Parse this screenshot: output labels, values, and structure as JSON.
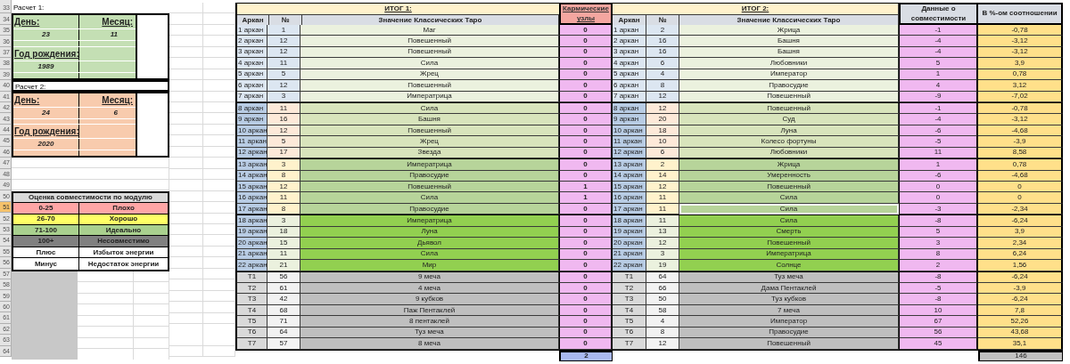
{
  "row_headers": [
    {
      "label": "33",
      "selected": false
    },
    {
      "label": "34",
      "selected": false
    },
    {
      "label": "35",
      "selected": false
    },
    {
      "label": "36",
      "selected": false
    },
    {
      "label": "37",
      "selected": false
    },
    {
      "label": "38",
      "selected": false
    },
    {
      "label": "39",
      "selected": false
    },
    {
      "label": "40",
      "selected": false
    },
    {
      "label": "41",
      "selected": false
    },
    {
      "label": "42",
      "selected": false
    },
    {
      "label": "43",
      "selected": false
    },
    {
      "label": "44",
      "selected": false
    },
    {
      "label": "45",
      "selected": false
    },
    {
      "label": "46",
      "selected": false
    },
    {
      "label": "47",
      "selected": false
    },
    {
      "label": "48",
      "selected": false
    },
    {
      "label": "49",
      "selected": false
    },
    {
      "label": "50",
      "selected": false
    },
    {
      "label": "51",
      "selected": true
    },
    {
      "label": "52",
      "selected": false
    },
    {
      "label": "53",
      "selected": false
    },
    {
      "label": "54",
      "selected": false
    },
    {
      "label": "55",
      "selected": false
    },
    {
      "label": "56",
      "selected": false
    },
    {
      "label": "57",
      "selected": false
    },
    {
      "label": "58",
      "selected": false
    },
    {
      "label": "59",
      "selected": false
    },
    {
      "label": "60",
      "selected": false
    },
    {
      "label": "61",
      "selected": false
    },
    {
      "label": "62",
      "selected": false
    },
    {
      "label": "63",
      "selected": false
    },
    {
      "label": "64",
      "selected": false
    }
  ],
  "calculations": [
    {
      "title": "Расчет 1:",
      "color": "#c4dfb4",
      "day_label": "День:",
      "day": "23",
      "month_label": "Месяц:",
      "month": "11",
      "year_label": "Год рождения:",
      "year": "1989"
    },
    {
      "title": "Расчет 2:",
      "color": "#f8cbad",
      "day_label": "День:",
      "day": "24",
      "month_label": "Месяц:",
      "month": "6",
      "year_label": "Год рождения:",
      "year": "2020"
    }
  ],
  "legend": {
    "title": "Оценка совместимости по модулю",
    "items": [
      {
        "range": "0-25",
        "verdict": "Плохо",
        "color": "#ffa6a6"
      },
      {
        "range": "26-70",
        "verdict": "Хорошо",
        "color": "#ffff66"
      },
      {
        "range": "71-100",
        "verdict": "Идеально",
        "color": "#a9d08e"
      },
      {
        "range": "100+",
        "verdict": "Несовместимо",
        "color": "#808080"
      },
      {
        "range": "Плюс",
        "verdict": "Избыток энергии",
        "color": "#ffffff"
      },
      {
        "range": "Минус",
        "verdict": "Недостаток энергии",
        "color": "#ffffff"
      }
    ]
  },
  "table": {
    "title_1": "ИТОГ 1:",
    "title_2": "ИТОГ 2:",
    "karmic_header": "Кармические узлы",
    "compat_header": "Данные о совместимости",
    "percent_header": "В %-ом соотношении",
    "columns_1": [
      "Аркан",
      "№",
      "Значение Классических Таро"
    ],
    "columns_2": [
      "Аркан",
      "№",
      "Значение Классических Таро"
    ],
    "sections": [
      {
        "kind": "first",
        "rows": [
          {
            "arcana_1": "1 аркан",
            "number_1": "1",
            "meaning_1": "Маг",
            "karmic": "0",
            "arcana_2": "1 аркан",
            "number_2": "2",
            "meaning_2": "Жрица",
            "compat": "-1",
            "percent": "-0,78",
            "selected": false
          },
          {
            "arcana_1": "2 аркан",
            "number_1": "12",
            "meaning_1": "Повешенный",
            "karmic": "0",
            "arcana_2": "2 аркан",
            "number_2": "16",
            "meaning_2": "Башня",
            "compat": "-4",
            "percent": "-3,12",
            "selected": false
          },
          {
            "arcana_1": "3 аркан",
            "number_1": "12",
            "meaning_1": "Повешенный",
            "karmic": "0",
            "arcana_2": "3 аркан",
            "number_2": "16",
            "meaning_2": "Башня",
            "compat": "-4",
            "percent": "-3,12",
            "selected": false
          },
          {
            "arcana_1": "4 аркан",
            "number_1": "11",
            "meaning_1": "Сила",
            "karmic": "0",
            "arcana_2": "4 аркан",
            "number_2": "6",
            "meaning_2": "Любовники",
            "compat": "5",
            "percent": "3,9",
            "selected": false
          },
          {
            "arcana_1": "5 аркан",
            "number_1": "5",
            "meaning_1": "Жрец",
            "karmic": "0",
            "arcana_2": "5 аркан",
            "number_2": "4",
            "meaning_2": "Император",
            "compat": "1",
            "percent": "0,78",
            "selected": false
          },
          {
            "arcana_1": "6 аркан",
            "number_1": "12",
            "meaning_1": "Повешенный",
            "karmic": "0",
            "arcana_2": "6 аркан",
            "number_2": "8",
            "meaning_2": "Правосудие",
            "compat": "4",
            "percent": "3,12",
            "selected": false
          },
          {
            "arcana_1": "7 аркан",
            "number_1": "3",
            "meaning_1": "Императрица",
            "karmic": "0",
            "arcana_2": "7 аркан",
            "number_2": "12",
            "meaning_2": "Повешенный",
            "compat": "-9",
            "percent": "-7,02",
            "selected": false
          }
        ]
      },
      {
        "kind": "second",
        "rows": [
          {
            "arcana_1": "8 аркан",
            "number_1": "11",
            "meaning_1": "Сила",
            "karmic": "0",
            "arcana_2": "8 аркан",
            "number_2": "12",
            "meaning_2": "Повешенный",
            "compat": "-1",
            "percent": "-0,78",
            "selected": false
          },
          {
            "arcana_1": "9 аркан",
            "number_1": "16",
            "meaning_1": "Башня",
            "karmic": "0",
            "arcana_2": "9 аркан",
            "number_2": "20",
            "meaning_2": "Суд",
            "compat": "-4",
            "percent": "-3,12",
            "selected": false
          },
          {
            "arcana_1": "10 аркан",
            "number_1": "12",
            "meaning_1": "Повешенный",
            "karmic": "0",
            "arcana_2": "10 аркан",
            "number_2": "18",
            "meaning_2": "Луна",
            "compat": "-6",
            "percent": "-4,68",
            "selected": false
          },
          {
            "arcana_1": "11 аркан",
            "number_1": "5",
            "meaning_1": "Жрец",
            "karmic": "0",
            "arcana_2": "11 аркан",
            "number_2": "10",
            "meaning_2": "Колесо фортуны",
            "compat": "-5",
            "percent": "-3,9",
            "selected": false
          },
          {
            "arcana_1": "12 аркан",
            "number_1": "17",
            "meaning_1": "Звезда",
            "karmic": "0",
            "arcana_2": "12 аркан",
            "number_2": "6",
            "meaning_2": "Любовники",
            "compat": "11",
            "percent": "8,58",
            "selected": false
          }
        ]
      },
      {
        "kind": "third",
        "rows": [
          {
            "arcana_1": "13 аркан",
            "number_1": "3",
            "meaning_1": "Императрица",
            "karmic": "0",
            "arcana_2": "13 аркан",
            "number_2": "2",
            "meaning_2": "Жрица",
            "compat": "1",
            "percent": "0,78",
            "selected": false
          },
          {
            "arcana_1": "14 аркан",
            "number_1": "8",
            "meaning_1": "Правосудие",
            "karmic": "0",
            "arcana_2": "14 аркан",
            "number_2": "14",
            "meaning_2": "Умеренность",
            "compat": "-6",
            "percent": "-4,68",
            "selected": false
          },
          {
            "arcana_1": "15 аркан",
            "number_1": "12",
            "meaning_1": "Повешенный",
            "karmic": "1",
            "arcana_2": "15 аркан",
            "number_2": "12",
            "meaning_2": "Повешенный",
            "compat": "0",
            "percent": "0",
            "selected": false
          },
          {
            "arcana_1": "16 аркан",
            "number_1": "11",
            "meaning_1": "Сила",
            "karmic": "1",
            "arcana_2": "16 аркан",
            "number_2": "11",
            "meaning_2": "Сила",
            "compat": "0",
            "percent": "0",
            "selected": false
          },
          {
            "arcana_1": "17 аркан",
            "number_1": "8",
            "meaning_1": "Правосудие",
            "karmic": "0",
            "arcana_2": "17 аркан",
            "number_2": "11",
            "meaning_2": "Сила",
            "compat": "-3",
            "percent": "-2,34",
            "selected": true
          }
        ]
      },
      {
        "kind": "fourth",
        "rows": [
          {
            "arcana_1": "18 аркан",
            "number_1": "3",
            "meaning_1": "Императрица",
            "karmic": "0",
            "arcana_2": "18 аркан",
            "number_2": "11",
            "meaning_2": "Сила",
            "compat": "-8",
            "percent": "-6,24",
            "selected": false
          },
          {
            "arcana_1": "19 аркан",
            "number_1": "18",
            "meaning_1": "Луна",
            "karmic": "0",
            "arcana_2": "19 аркан",
            "number_2": "13",
            "meaning_2": "Смерть",
            "compat": "5",
            "percent": "3,9",
            "selected": false
          },
          {
            "arcana_1": "20 аркан",
            "number_1": "15",
            "meaning_1": "Дьявол",
            "karmic": "0",
            "arcana_2": "20 аркан",
            "number_2": "12",
            "meaning_2": "Повешенный",
            "compat": "3",
            "percent": "2,34",
            "selected": false
          },
          {
            "arcana_1": "21 аркан",
            "number_1": "11",
            "meaning_1": "Сила",
            "karmic": "0",
            "arcana_2": "21 аркан",
            "number_2": "3",
            "meaning_2": "Императрица",
            "compat": "8",
            "percent": "6,24",
            "selected": false
          },
          {
            "arcana_1": "22 аркан",
            "number_1": "21",
            "meaning_1": "Мир",
            "karmic": "0",
            "arcana_2": "22 аркан",
            "number_2": "19",
            "meaning_2": "Солнце",
            "compat": "2",
            "percent": "1,56",
            "selected": false
          }
        ]
      },
      {
        "kind": "extra",
        "rows": [
          {
            "arcana_1": "T1",
            "number_1": "56",
            "meaning_1": "9 меча",
            "karmic": "0",
            "arcana_2": "T1",
            "number_2": "64",
            "meaning_2": "Туз меча",
            "compat": "-8",
            "percent": "-6,24",
            "selected": false
          },
          {
            "arcana_1": "T2",
            "number_1": "61",
            "meaning_1": "4 меча",
            "karmic": "0",
            "arcana_2": "T2",
            "number_2": "66",
            "meaning_2": "Дама Пентаклей",
            "compat": "-5",
            "percent": "-3,9",
            "selected": false
          },
          {
            "arcana_1": "T3",
            "number_1": "42",
            "meaning_1": "9 кубков",
            "karmic": "0",
            "arcana_2": "T3",
            "number_2": "50",
            "meaning_2": "Туз кубков",
            "compat": "-8",
            "percent": "-6,24",
            "selected": false
          },
          {
            "arcana_1": "T4",
            "number_1": "68",
            "meaning_1": "Паж Пентаклей",
            "karmic": "0",
            "arcana_2": "T4",
            "number_2": "58",
            "meaning_2": "7 меча",
            "compat": "10",
            "percent": "7,8",
            "selected": false
          },
          {
            "arcana_1": "T5",
            "number_1": "71",
            "meaning_1": "8 пентаклей",
            "karmic": "0",
            "arcana_2": "T5",
            "number_2": "4",
            "meaning_2": "Император",
            "compat": "67",
            "percent": "52,26",
            "selected": false
          },
          {
            "arcana_1": "T6",
            "number_1": "64",
            "meaning_1": "Туз меча",
            "karmic": "0",
            "arcana_2": "T6",
            "number_2": "8",
            "meaning_2": "Правосудие",
            "compat": "56",
            "percent": "43,68",
            "selected": false
          },
          {
            "arcana_1": "T7",
            "number_1": "57",
            "meaning_1": "8 меча",
            "karmic": "0",
            "arcana_2": "T7",
            "number_2": "12",
            "meaning_2": "Повешенный",
            "compat": "45",
            "percent": "35,1",
            "selected": false
          }
        ]
      }
    ],
    "karmic_total": "2",
    "percent_total": "146"
  }
}
